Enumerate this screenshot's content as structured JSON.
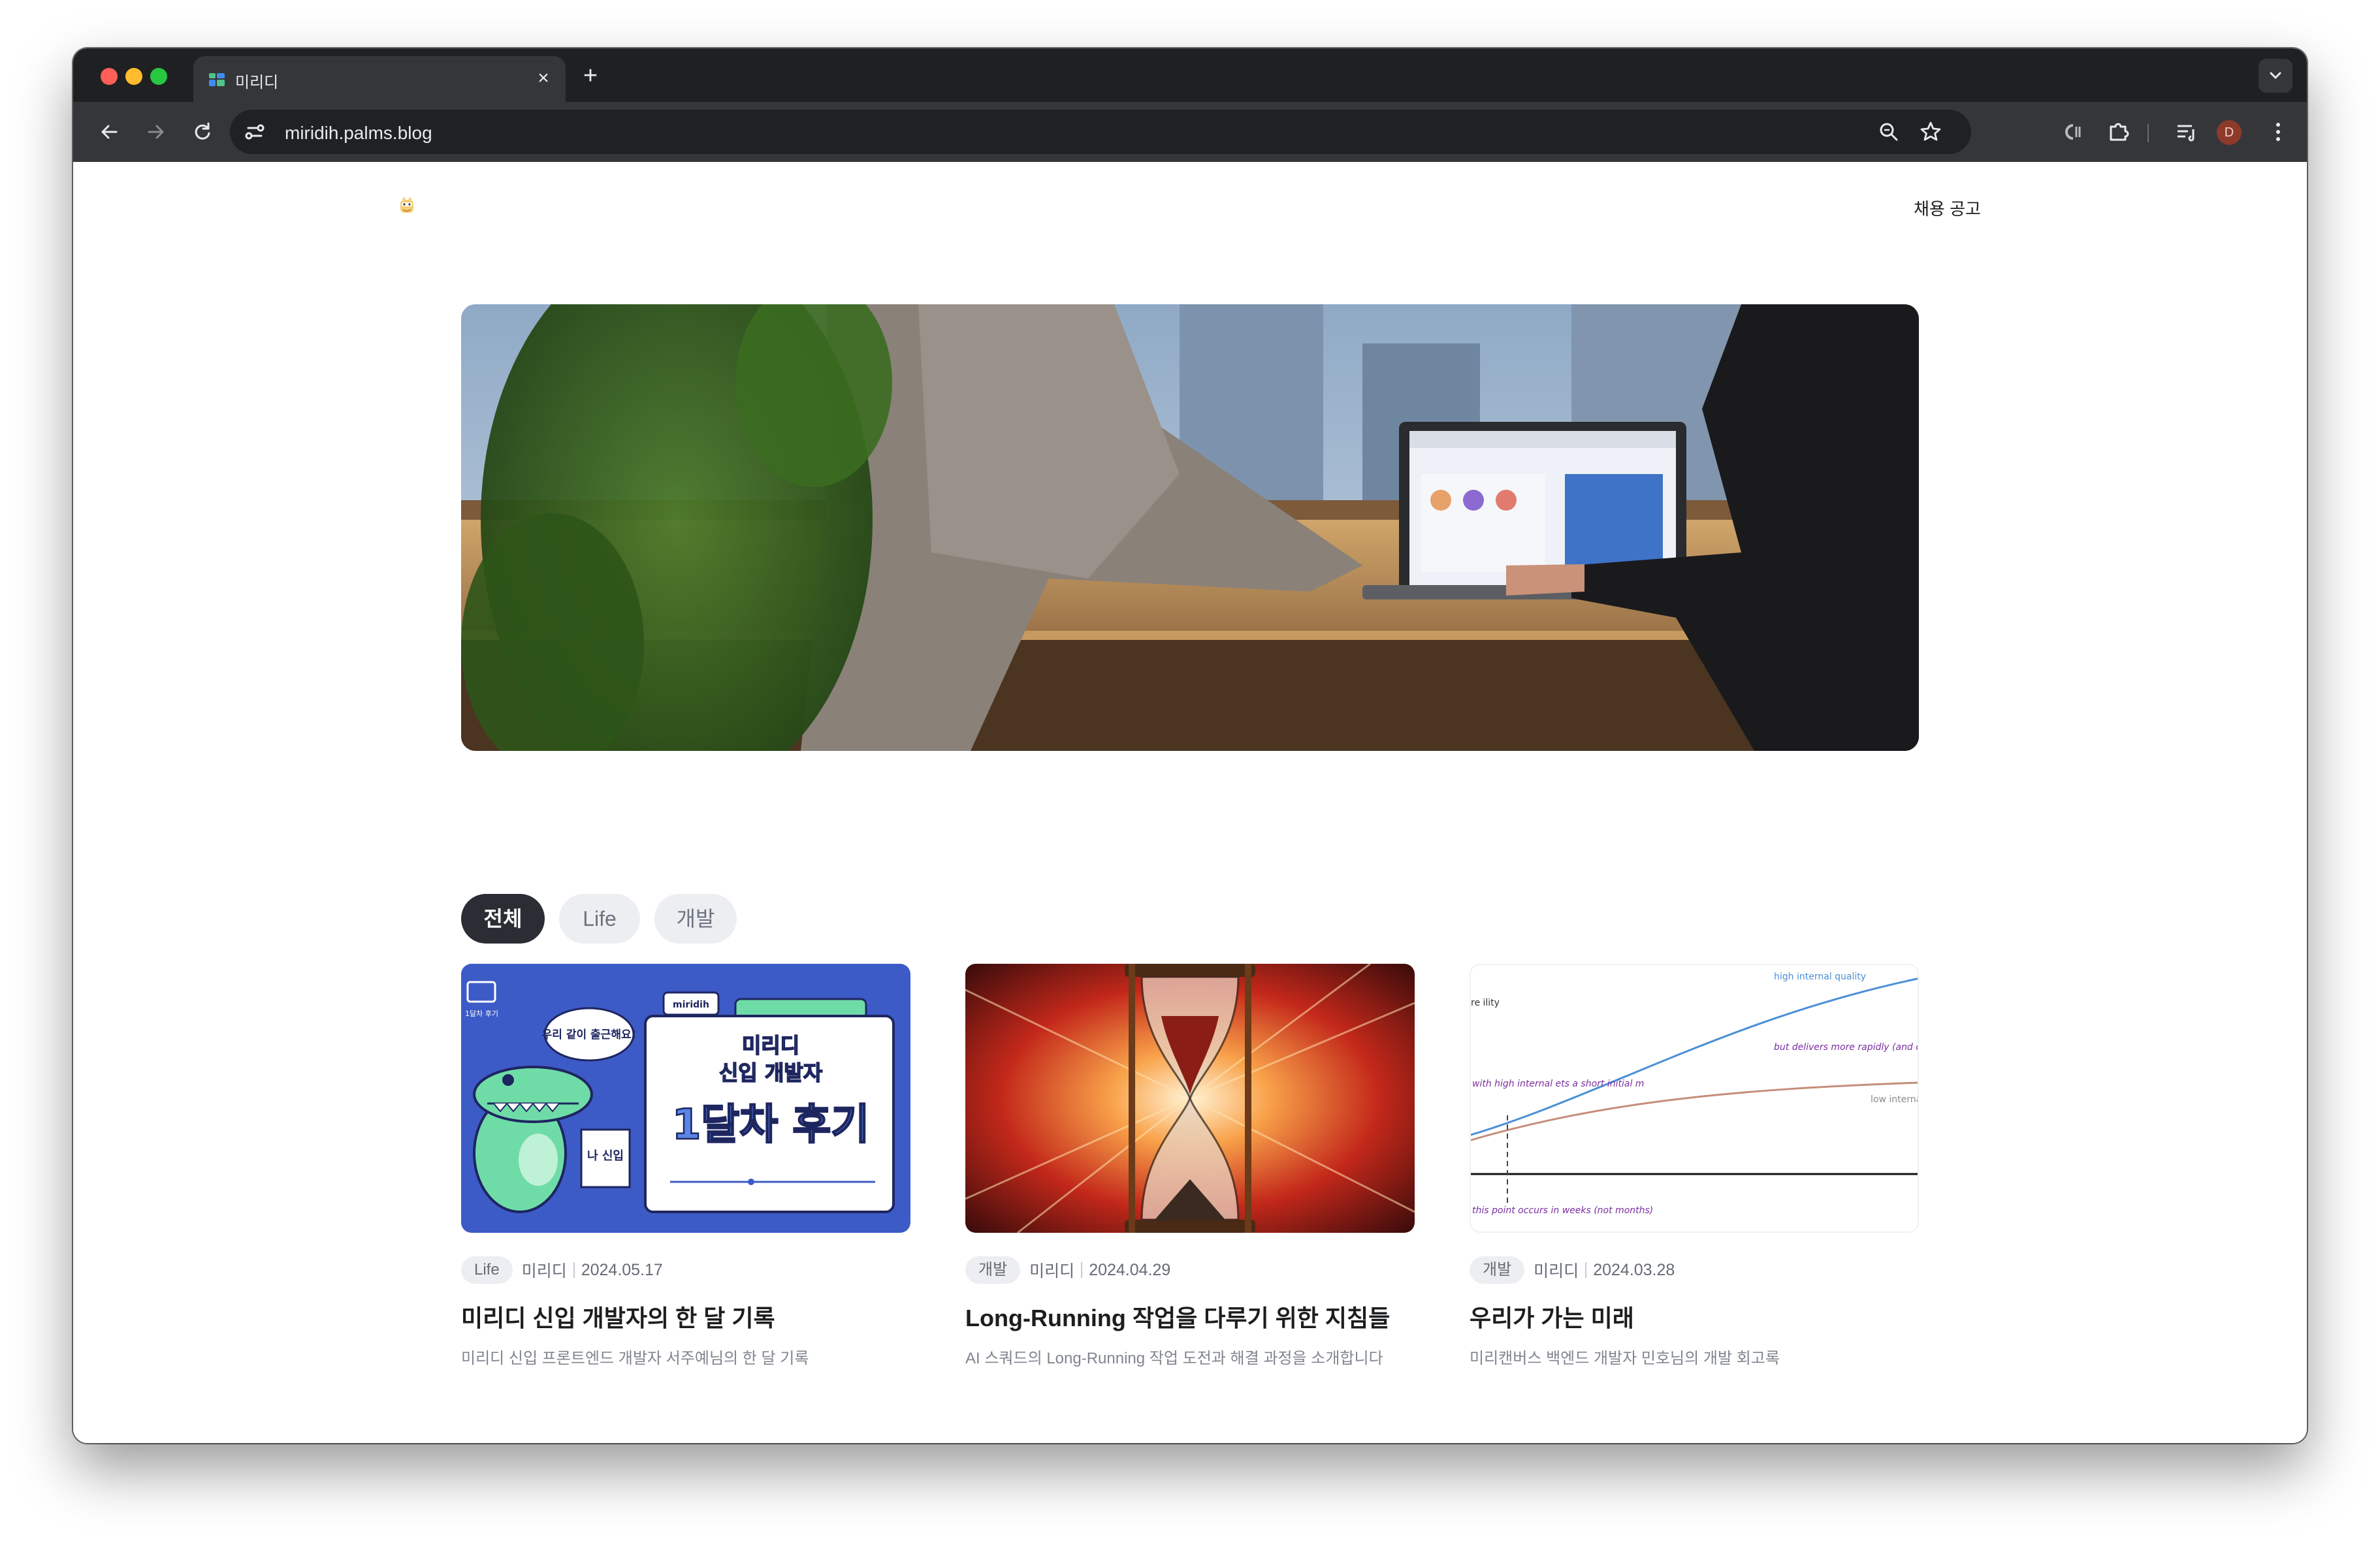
{
  "browser": {
    "tab_title": "미리디",
    "url": "miridih.palms.blog",
    "profile_initial": "D"
  },
  "site": {
    "nav_link": "채용 공고"
  },
  "filters": [
    "전체",
    "Life",
    "개발"
  ],
  "active_filter": "전체",
  "cards": [
    {
      "tag": "Life",
      "author": "미리디",
      "date": "2024.05.17",
      "title": "미리디 신입 개발자의 한 달 기록",
      "description": "미리디 신입 프론트엔드 개발자 서주예님의 한 달 기록",
      "thumb": {
        "folder_label": "1달차 후기",
        "bubble": "우리 같이 출근해요!",
        "sign": "나 신입",
        "tab_label": "miridih",
        "headline_line1": "미리디",
        "headline_line2": "신입 개발자",
        "headline_big": "1달차 후기"
      }
    },
    {
      "tag": "개발",
      "author": "미리디",
      "date": "2024.04.29",
      "title": "Long-Running 작업을 다루기 위한 지침들",
      "description": "AI 스쿼드의 Long-Running 작업 도전과 해결 과정을 소개합니다"
    },
    {
      "tag": "개발",
      "author": "미리디",
      "date": "2024.03.28",
      "title": "우리가 가는 미래",
      "description": "미리캔버스 백엔드 개발자 민호님의 개발 회고록",
      "thumb": {
        "label_high": "high internal quality",
        "label_low": "low interna",
        "label_rapid": "but delivers more rapidly (and cheaply) later",
        "label_short": "with high internal ets a short initial m",
        "label_point": "this point occurs in weeks (not months)",
        "label_axis": "re ility"
      }
    }
  ],
  "colors": {
    "active_chip": "#2a2d33",
    "chip": "#eceef1",
    "thumb1_bg": "#3d5bc7",
    "thumb1_green": "#6fdca8",
    "high_line": "#4a8fd6",
    "low_line": "#c48e7a",
    "annotation": "#7a2ea0"
  }
}
